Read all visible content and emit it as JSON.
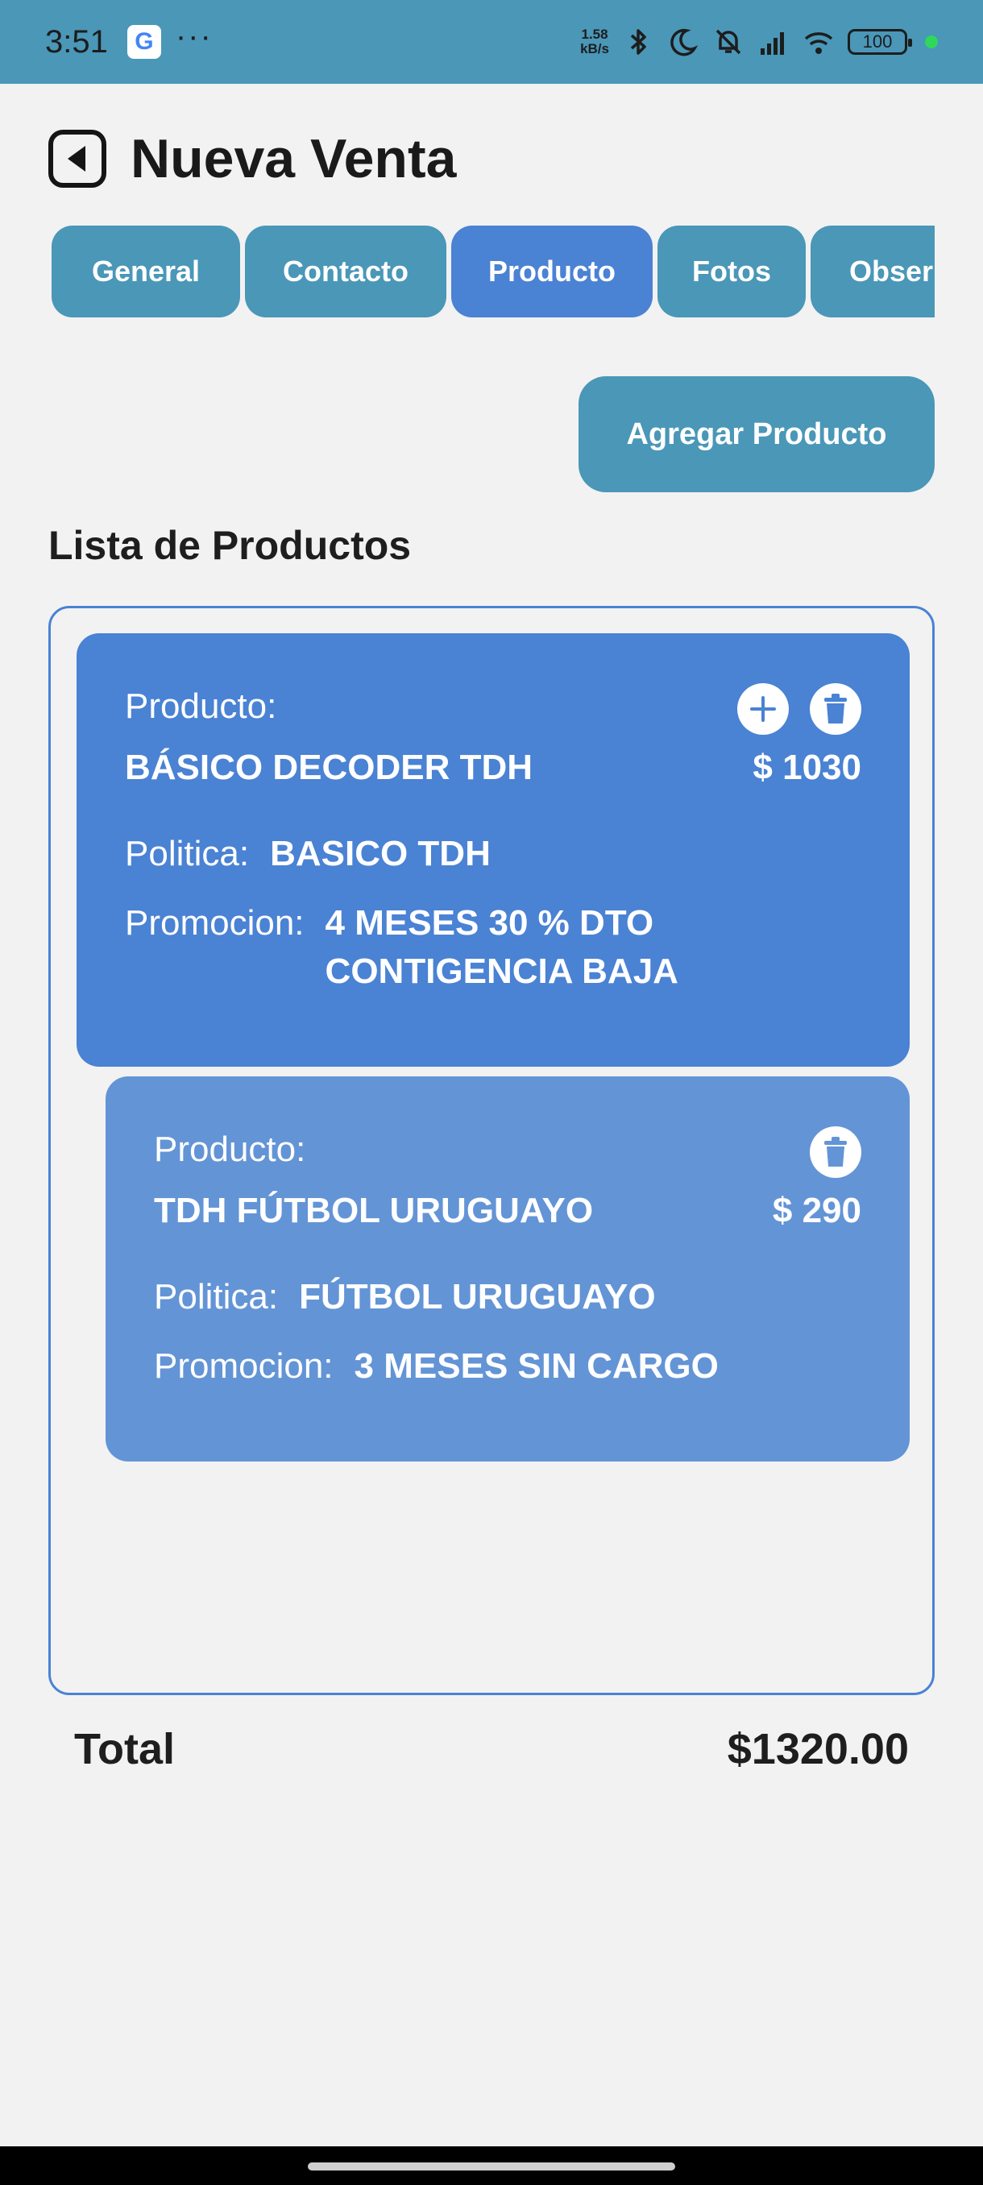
{
  "status_bar": {
    "time": "3:51",
    "google_glyph": "G",
    "more_dots": "···",
    "net_speed_value": "1.58",
    "net_speed_unit": "kB/s",
    "battery": "100"
  },
  "header": {
    "title": "Nueva Venta"
  },
  "tabs": [
    {
      "label": "General"
    },
    {
      "label": "Contacto"
    },
    {
      "label": "Producto"
    },
    {
      "label": "Fotos"
    },
    {
      "label": "Obser"
    }
  ],
  "active_tab": "Producto",
  "add_button_label": "Agregar Producto",
  "list_title": "Lista de Productos",
  "products": [
    {
      "label": "Producto:",
      "name": "BÁSICO DECODER TDH",
      "price": "$ 1030",
      "politica_label": "Politica:",
      "politica": "BASICO TDH",
      "promocion_label": "Promocion:",
      "promocion_line1": "4 MESES 30 % DTO",
      "promocion_line2": "CONTIGENCIA BAJA"
    },
    {
      "label": "Producto:",
      "name": "TDH FÚTBOL URUGUAYO",
      "price": "$ 290",
      "politica_label": "Politica:",
      "politica": "FÚTBOL URUGUAYO",
      "promocion_label": "Promocion:",
      "promocion": "3 MESES SIN CARGO"
    }
  ],
  "total": {
    "label": "Total",
    "value": "$1320.00"
  },
  "colors": {
    "teal": "#4a97b8",
    "active_blue": "#4a82d4",
    "sub_card_blue": "#6394d6",
    "background": "#f2f2f2"
  }
}
